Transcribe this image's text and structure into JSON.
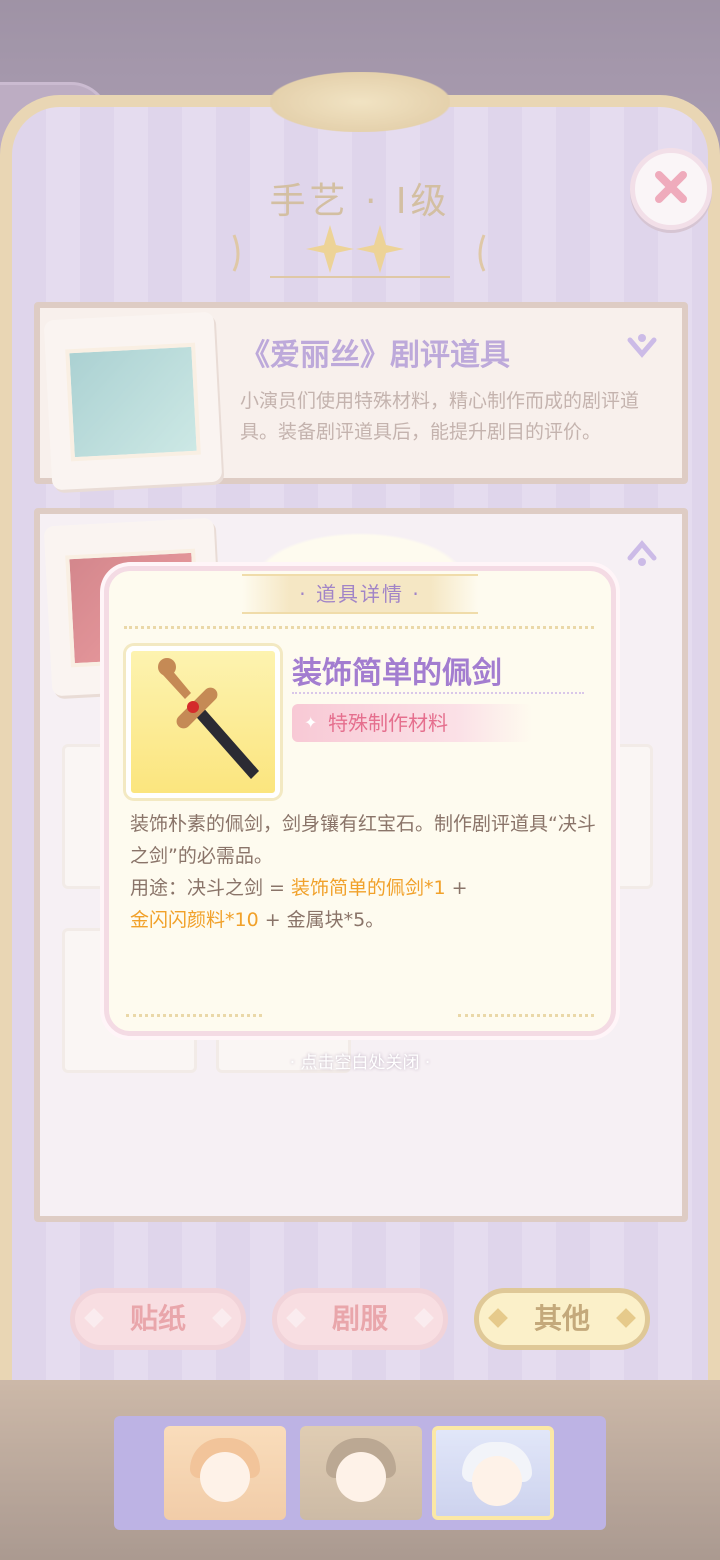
{
  "header": {
    "title": "手艺 · Ⅰ级",
    "close_icon": "close-icon",
    "back_icon": "back-arrow-icon"
  },
  "items": [
    {
      "title": "《爱丽丝》剧评道具",
      "desc": "小演员们使用特殊材料，精心制作而成的剧评道具。装备剧评道具后，能提升剧目的评价。",
      "state": "collapsed"
    },
    {
      "title": "",
      "state": "expanded"
    }
  ],
  "popup": {
    "tag": "· 道具详情 ·",
    "name": "装饰简单的佩剑",
    "type": "特殊制作材料",
    "desc_line1": "装饰朴素的佩剑，剑身镶有红宝石。制作剧评道具“决斗之剑”的必需品。",
    "usage_prefix": "用途：决斗之剑 = ",
    "usage_hl1": "装饰简单的佩剑*1",
    "usage_mid": " + ",
    "usage_hl2": "金闪闪颜料*10",
    "usage_suffix": " + 金属块*5。",
    "tap_to_close": "· 点击空白处关闭 ·"
  },
  "tabs": [
    {
      "label": "贴纸",
      "active": false
    },
    {
      "label": "剧服",
      "active": false
    },
    {
      "label": "其他",
      "active": true
    }
  ],
  "colors": {
    "accent_purple": "#a37dd0",
    "highlight_orange": "#f1a12a",
    "tab_pink": "#d9676e",
    "tab_gold": "#9a6b1d"
  }
}
